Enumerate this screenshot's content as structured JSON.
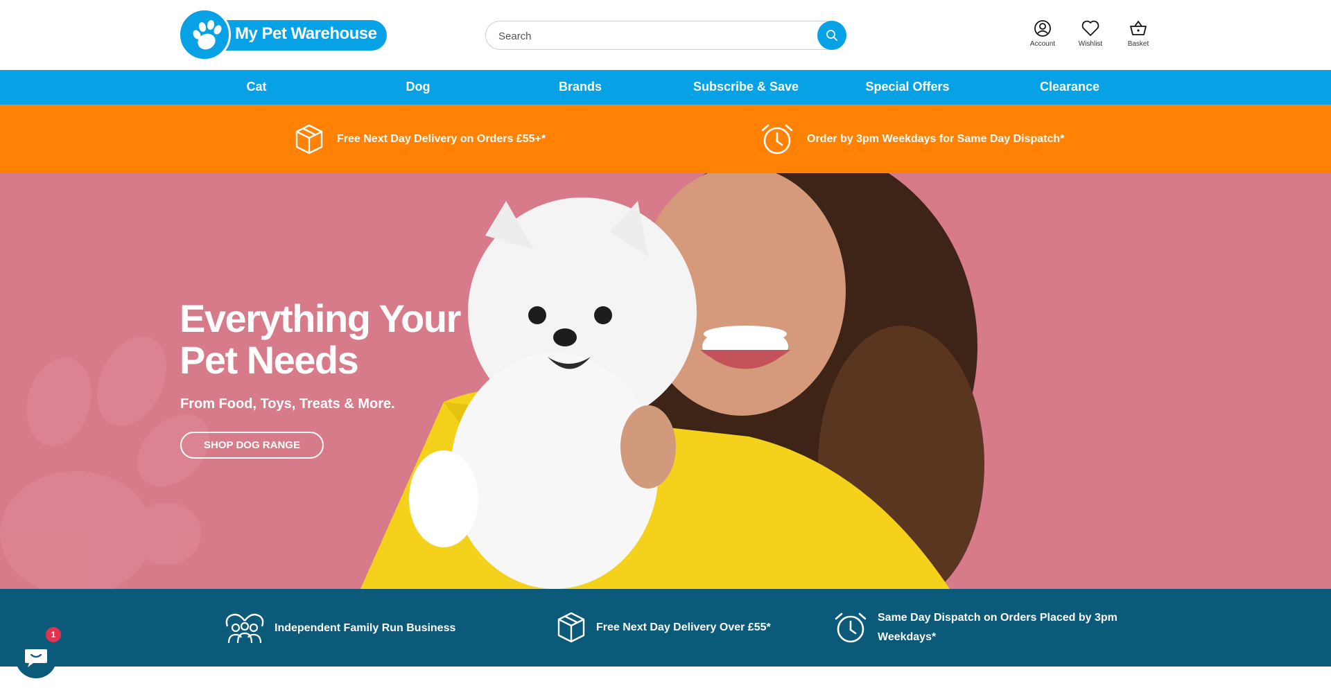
{
  "brand": {
    "name": "My Pet Warehouse",
    "color": "#07a1e6",
    "logo_icon": "paw-icon"
  },
  "search": {
    "placeholder": "Search",
    "icon": "search-icon"
  },
  "header_icons": [
    {
      "label": "Account",
      "icon": "user-icon"
    },
    {
      "label": "Wishlist",
      "icon": "heart-icon"
    },
    {
      "label": "Basket",
      "icon": "basket-icon"
    }
  ],
  "nav": {
    "items": [
      "Cat",
      "Dog",
      "Brands",
      "Subscribe & Save",
      "Special Offers",
      "Clearance"
    ],
    "color": "#07a1e6"
  },
  "promo": {
    "color": "#ff8205",
    "items": [
      {
        "icon": "box-icon",
        "text": "Free Next Day Delivery on Orders £55+*"
      },
      {
        "icon": "alarm-clock-icon",
        "text": "Order by 3pm Weekdays for Same Day Dispatch*"
      }
    ]
  },
  "hero": {
    "title_line1": "Everything Your",
    "title_line2": "Pet Needs",
    "subtitle": "From Food, Toys, Treats & More.",
    "button": "SHOP DOG RANGE",
    "bg_color": "#d77b8b"
  },
  "usp": {
    "color": "#0b5a7a",
    "items": [
      {
        "icon": "family-icon",
        "text": "Independent Family Run Business"
      },
      {
        "icon": "box-icon",
        "text": "Free Next Day Delivery Over £55*"
      },
      {
        "icon": "alarm-clock-icon",
        "text_line1": "Same Day Dispatch on Orders Placed by 3pm",
        "text_line2": "Weekdays*"
      }
    ]
  },
  "chat": {
    "icon": "chat-bubble-icon",
    "badge": "1"
  }
}
